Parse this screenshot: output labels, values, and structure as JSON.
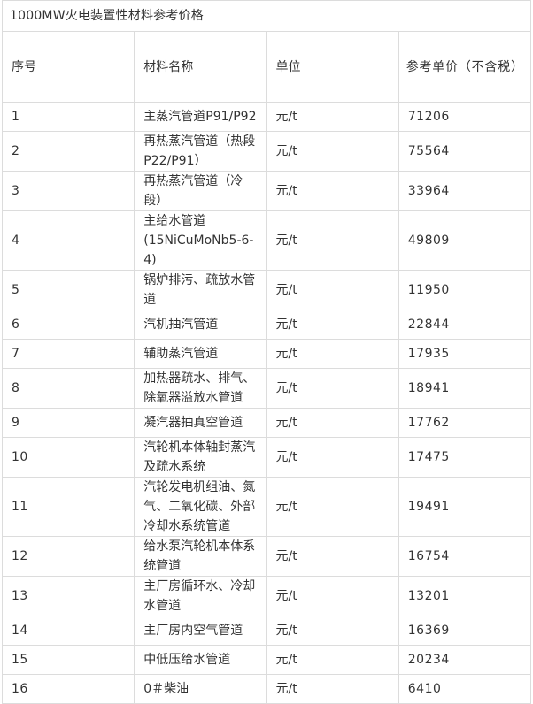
{
  "table": {
    "title": "1000MW火电装置性材料参考价格",
    "headers": {
      "no": "序号",
      "name": "材料名称",
      "unit": "单位",
      "price": "参考单价（不含税）"
    },
    "rows": [
      {
        "no": "1",
        "name": "主蒸汽管道P91/P92",
        "unit": "元/t",
        "price": "71206"
      },
      {
        "no": "2",
        "name": "再热蒸汽管道（热段P22/P91）",
        "unit": "元/t",
        "price": "75564"
      },
      {
        "no": "3",
        "name": "再热蒸汽管道（冷段）",
        "unit": "元/t",
        "price": "33964"
      },
      {
        "no": "4",
        "name": "主给水管道(15NiCuMoNb5-6-4)",
        "unit": "元/t",
        "price": "49809"
      },
      {
        "no": "5",
        "name": "锅炉排污、疏放水管道",
        "unit": "元/t",
        "price": "11950"
      },
      {
        "no": "6",
        "name": "汽机抽汽管道",
        "unit": "元/t",
        "price": "22844"
      },
      {
        "no": "7",
        "name": "辅助蒸汽管道",
        "unit": "元/t",
        "price": "17935"
      },
      {
        "no": "8",
        "name": "加热器疏水、排气、除氧器溢放水管道",
        "unit": "元/t",
        "price": "18941"
      },
      {
        "no": "9",
        "name": "凝汽器抽真空管道",
        "unit": "元/t",
        "price": "17762"
      },
      {
        "no": "10",
        "name": "汽轮机本体轴封蒸汽及疏水系统",
        "unit": "元/t",
        "price": "17475"
      },
      {
        "no": "11",
        "name": "汽轮发电机组油、氮气、二氧化碳、外部冷却水系统管道",
        "unit": "元/t",
        "price": "19491"
      },
      {
        "no": "12",
        "name": "给水泵汽轮机本体系统管道",
        "unit": "元/t",
        "price": "16754"
      },
      {
        "no": "13",
        "name": "主厂房循环水、冷却水管道",
        "unit": "元/t",
        "price": "13201"
      },
      {
        "no": "14",
        "name": "主厂房内空气管道",
        "unit": "元/t",
        "price": "16369"
      },
      {
        "no": "15",
        "name": "中低压给水管道",
        "unit": "元/t",
        "price": "20234"
      },
      {
        "no": "16",
        "name": "0＃柴油",
        "unit": "元/t",
        "price": "6410"
      }
    ]
  }
}
